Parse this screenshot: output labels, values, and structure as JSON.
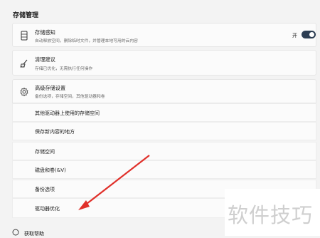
{
  "section_title": "存储管理",
  "storage_sense": {
    "title": "存储感知",
    "subtitle": "自动释放空间，删除临时文件，并管理本地可用的云内容",
    "toggle_label": "开",
    "toggle_on": true,
    "icon": "storage-drive-icon"
  },
  "cleanup": {
    "title": "清理建议",
    "subtitle": "存储已优化，无需执行任何操作",
    "icon": "broom-icon"
  },
  "advanced": {
    "title": "高级存储设置",
    "subtitle": "备份选项，存储空间，其他驱动器和卷",
    "icon": "gear-icon",
    "items": [
      {
        "label": "其他驱动器上使用的存储空间"
      },
      {
        "label": "保存新内容的地方"
      },
      {
        "label": "存储空间"
      },
      {
        "label": "磁盘和卷(&V)"
      },
      {
        "label": "备份选项"
      },
      {
        "label": "驱动器优化"
      }
    ]
  },
  "help": {
    "label": "获取帮助",
    "icon": "help-icon"
  },
  "watermark": "软件技巧",
  "colors": {
    "toggle": "#2c3d52",
    "arrow": "#e0302a",
    "background": "#f3f3f3"
  }
}
